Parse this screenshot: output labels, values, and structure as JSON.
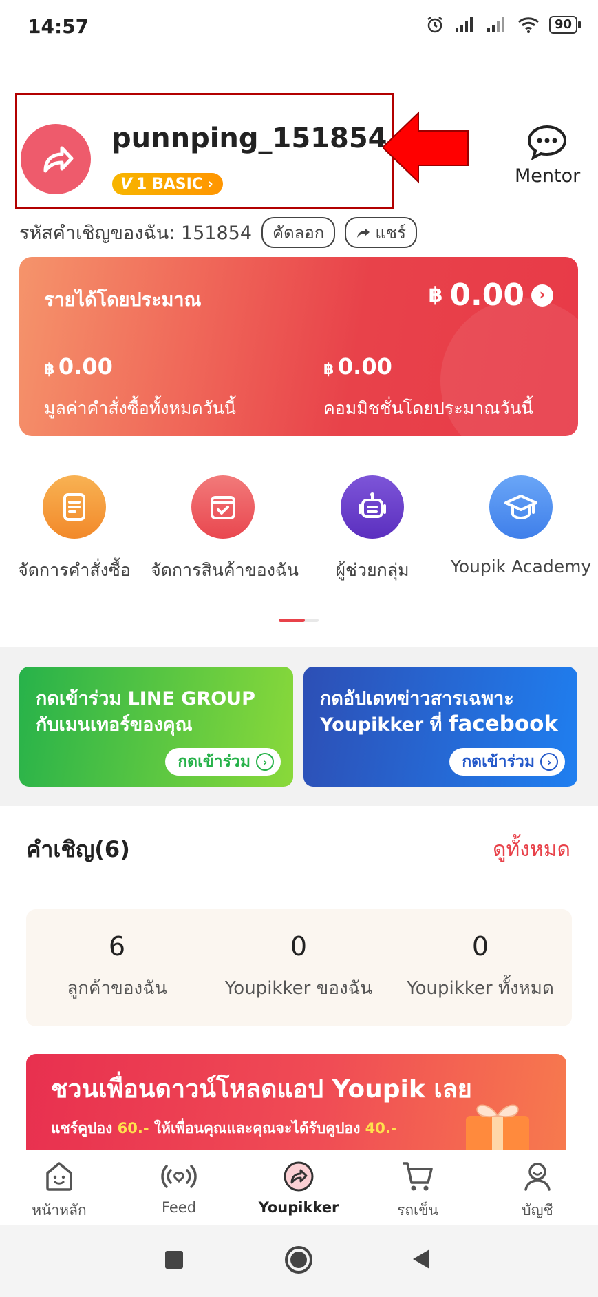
{
  "status_bar": {
    "time": "14:57",
    "battery": "90"
  },
  "profile": {
    "username": "punnping_151854",
    "level_badge": "1 BASIC",
    "mentor_label": "Mentor",
    "invite_code_label": "รหัสคำเชิญของฉัน: 151854",
    "copy_label": "คัดลอก",
    "share_label": "แชร์"
  },
  "earnings": {
    "title": "รายได้โดยประมาณ",
    "currency": "฿",
    "total": "0.00",
    "order_value": "0.00",
    "order_value_label": "มูลค่าคำสั่งซื้อทั้งหมดวันนี้",
    "commission": "0.00",
    "commission_label": "คอมมิชชั่นโดยประมาณวันนี้"
  },
  "quick_actions": [
    {
      "label": "จัดการคำสั่งซื้อ",
      "color": "#f59a3a"
    },
    {
      "label": "จัดการสินค้าของฉัน",
      "color": "#ec5a60"
    },
    {
      "label": "ผู้ช่วยกลุ่ม",
      "color": "#6a3fc7"
    },
    {
      "label": "Youpik Academy",
      "color": "#4f8ef0"
    }
  ],
  "promos": {
    "line": {
      "line1": "กดเข้าร่วม LINE GROUP",
      "line2": "กับเมนเทอร์ของคุณ",
      "button": "กดเข้าร่วม"
    },
    "facebook": {
      "line1": "กดอัปเดทข่าวสารเฉพาะ",
      "line2a": "Youpikker ที่ ",
      "line2b": "facebook",
      "button": "กดเข้าร่วม"
    }
  },
  "invitations": {
    "title": "คำเชิญ(6)",
    "view_all": "ดูทั้งหมด",
    "stats": [
      {
        "value": "6",
        "label": "ลูกค้าของฉัน"
      },
      {
        "value": "0",
        "label": "Youpikker ของฉัน"
      },
      {
        "value": "0",
        "label": "Youpikker ทั้งหมด"
      }
    ]
  },
  "referral_banner": {
    "title": "ชวนเพื่อนดาวน์โหลดแอป Youpik เลย",
    "sub_a": "แชร์คูปอง ",
    "sub_b": "60.-",
    "sub_c": " ให้เพื่อนคุณและคุณจะได้รับคูปอง ",
    "sub_d": "40.-"
  },
  "bottom_nav": [
    {
      "label": "หน้าหลัก",
      "icon": "home-icon"
    },
    {
      "label": "Feed",
      "icon": "feed-icon"
    },
    {
      "label": "Youpikker",
      "icon": "youpikker-icon",
      "active": true
    },
    {
      "label": "รถเข็น",
      "icon": "cart-icon"
    },
    {
      "label": "บัญชี",
      "icon": "account-icon"
    }
  ],
  "colors": {
    "accent": "#e8424a",
    "highlight": "#b20000",
    "arrow": "#ff0000"
  }
}
